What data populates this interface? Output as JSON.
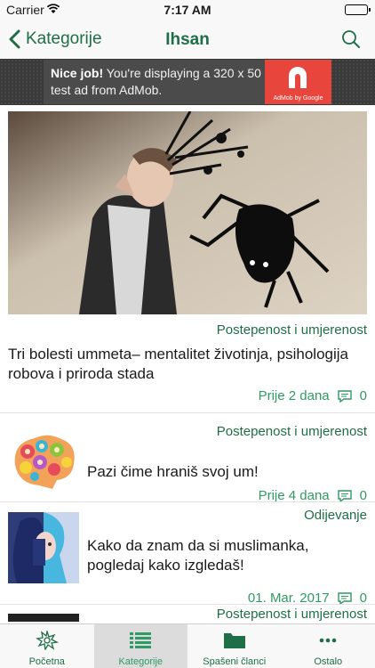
{
  "status": {
    "carrier": "Carrier",
    "time": "7:17 AM"
  },
  "nav": {
    "back_label": "Kategorije",
    "title": "Ihsan"
  },
  "ad": {
    "headline": "Nice job!",
    "body": "You're displaying a 320 x 50 test ad from AdMob.",
    "logo_caption": "AdMob by Google"
  },
  "articles": [
    {
      "category": "Postepenost i umjerenost",
      "title": "Tri bolesti ummeta– mentalitet životinja, psihologija robova i priroda stada",
      "date": "Prije 2 dana",
      "comments": "0"
    },
    {
      "category": "Postepenost i umjerenost",
      "title": "Pazi čime hraniš svoj um!",
      "date": "Prije 4 dana",
      "comments": "0"
    },
    {
      "category": "Odijevanje",
      "title": "Kako da znam da si muslimanka, pogledaj kako izgledaš!",
      "date": "01. Mar. 2017",
      "comments": "0"
    },
    {
      "category": "Postepenost i umjerenost"
    }
  ],
  "tabs": [
    {
      "label": "Početna",
      "icon": "home-ornament-icon"
    },
    {
      "label": "Kategorije",
      "icon": "list-icon",
      "active": true
    },
    {
      "label": "Spašeni članci",
      "icon": "folder-icon"
    },
    {
      "label": "Ostalo",
      "icon": "more-icon"
    }
  ],
  "colors": {
    "accent": "#1e6e47",
    "meta": "#2f9a63",
    "bar": "#f8f8f8",
    "active_tab": "#dcdcdc"
  }
}
